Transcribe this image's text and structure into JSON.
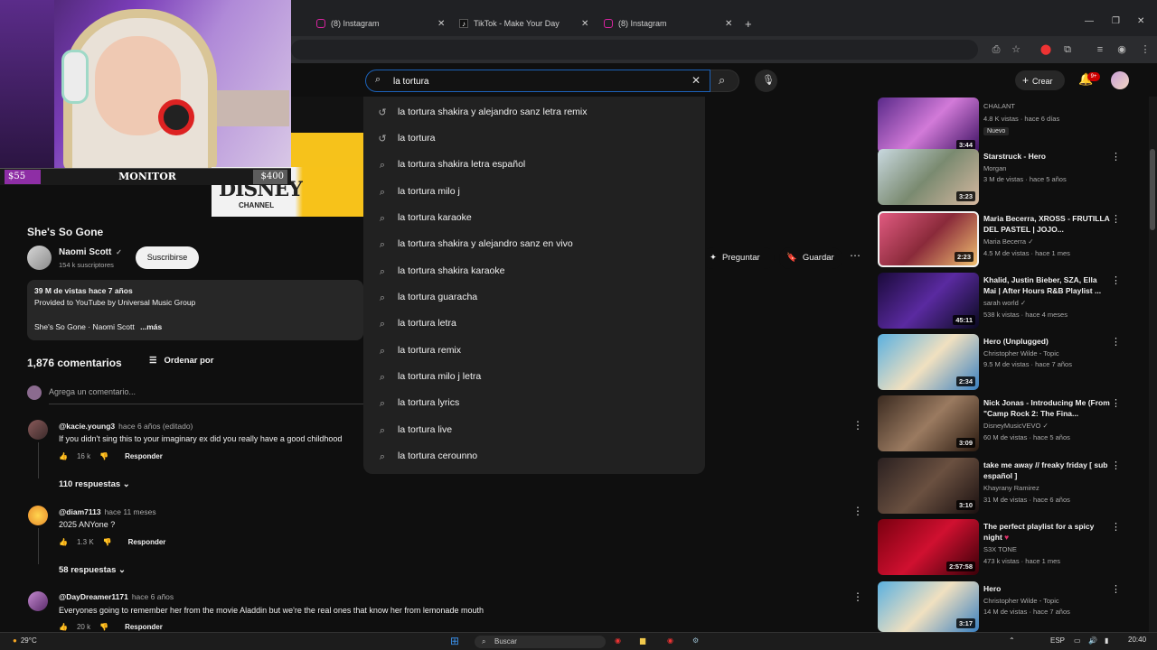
{
  "browser": {
    "tabs": [
      {
        "label": "(8) Instagram",
        "icon": "instagram-icon"
      },
      {
        "label": "TikTok - Make Your Day",
        "icon": "tiktok-icon"
      },
      {
        "label": "(8) Instagram",
        "icon": "instagram-icon"
      }
    ],
    "new_tab": "+"
  },
  "overlay": {
    "left_price": "$55",
    "center_label": "MONITOR",
    "right_price": "$400",
    "disney_logo": "DISNEY",
    "disney_channel": "CHANNEL"
  },
  "header": {
    "search_value": "la tortura",
    "create_label": "Crear",
    "notif_count": "9+"
  },
  "suggestions": [
    {
      "text": "la tortura shakira y alejandro sanz letra remix",
      "icon": "history-icon"
    },
    {
      "text": "la tortura",
      "icon": "history-icon"
    },
    {
      "text": "la tortura shakira letra español",
      "icon": "search-icon"
    },
    {
      "text": "la tortura milo j",
      "icon": "search-icon"
    },
    {
      "text": "la tortura karaoke",
      "icon": "search-icon"
    },
    {
      "text": "la tortura shakira y alejandro sanz en vivo",
      "icon": "search-icon"
    },
    {
      "text": "la tortura shakira karaoke",
      "icon": "search-icon"
    },
    {
      "text": "la tortura guaracha",
      "icon": "search-icon"
    },
    {
      "text": "la tortura letra",
      "icon": "search-icon"
    },
    {
      "text": "la tortura remix",
      "icon": "search-icon"
    },
    {
      "text": "la tortura milo j letra",
      "icon": "search-icon"
    },
    {
      "text": "la tortura lyrics",
      "icon": "search-icon"
    },
    {
      "text": "la tortura live",
      "icon": "search-icon"
    },
    {
      "text": "la tortura cerounno",
      "icon": "search-icon"
    }
  ],
  "video": {
    "title": "She's So Gone",
    "channel": "Naomi Scott",
    "subs": "154 k suscriptores",
    "subscribe_label": "Suscribirse",
    "ask_label": "Preguntar",
    "save_label": "Guardar",
    "desc_stats": "39 M de vistas  hace 7 años",
    "desc_line1": "Provided to YouTube by Universal Music Group",
    "desc_line2": "She's So Gone · Naomi Scott",
    "desc_more": "...más"
  },
  "comments": {
    "count_label": "1,876 comentarios",
    "sort_label": "Ordenar por",
    "add_placeholder": "Agrega un comentario...",
    "reply_label": "Responder",
    "items": [
      {
        "user": "@kacie.young3",
        "time": "hace 6 años (editado)",
        "text": "If you didn't sing this to your imaginary ex did you really have a good childhood",
        "likes": "16 k",
        "replies": "110 respuestas"
      },
      {
        "user": "@diam7113",
        "time": "hace 11 meses",
        "text": "2025 ANYone ?",
        "likes": "1.3 K",
        "replies": "58 respuestas"
      },
      {
        "user": "@DayDreamer1171",
        "time": "hace 6 años",
        "text": "Everyones going to remember her from the movie Aladdin but we're the real ones that know her from lemonade mouth",
        "likes": "20 k",
        "replies": ""
      }
    ]
  },
  "recommendations": [
    {
      "title": "",
      "channel": "CHALANT",
      "meta": "4.8 K vistas · hace 6 días",
      "duration": "3:44",
      "badge": "Nuevo"
    },
    {
      "title": "Starstruck - Hero",
      "channel": "Morgan",
      "meta": "3 M de vistas · hace 5 años",
      "duration": "3:23"
    },
    {
      "title": "Maria Becerra, XROSS - FRUTILLA DEL PASTEL | JOJO...",
      "channel": "Maria Becerra",
      "meta": "4.5 M de vistas · hace 1 mes",
      "duration": "2:23"
    },
    {
      "title": "Khalid, Justin Bieber, SZA, Ella Mai | After Hours R&B Playlist ...",
      "channel": "sarah world",
      "meta": "538 k vistas · hace 4 meses",
      "duration": "45:11"
    },
    {
      "title": "Hero (Unplugged)",
      "channel": "Christopher Wilde - Topic",
      "meta": "9.5 M de vistas · hace 7 años",
      "duration": "2:34"
    },
    {
      "title": "Nick Jonas - Introducing Me (From \"Camp Rock 2: The Fina...",
      "channel": "DisneyMusicVEVO",
      "meta": "60 M de vistas · hace 5 años",
      "duration": "3:09"
    },
    {
      "title": "take me away // freaky friday [ sub español ]",
      "channel": "Khayrany Ramirez",
      "meta": "31 M de vistas · hace 6 años",
      "duration": "3:10"
    },
    {
      "title": "The perfect playlist for a spicy night",
      "channel": "S3X TONE",
      "meta": "473 k vistas · hace 1 mes",
      "duration": "2:57:58"
    },
    {
      "title": "Hero",
      "channel": "Christopher Wilde - Topic",
      "meta": "14 M de vistas · hace 7 años",
      "duration": "3:17"
    }
  ],
  "taskbar": {
    "weather": "29°C",
    "search_label": "Buscar",
    "lang": "ESP",
    "time": "20:40"
  },
  "colors": {
    "bg": "#0f0f0f",
    "accent_red": "#cc0000",
    "search_border": "#1c62b9",
    "purple_overlay": "#8e2ea5"
  }
}
